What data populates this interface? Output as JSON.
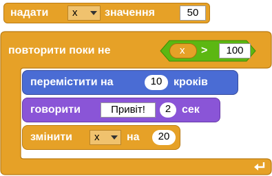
{
  "set_block": {
    "label": "надати",
    "variable": "x",
    "label2": "значення",
    "value": "50"
  },
  "repeat_block": {
    "label": "повторити поки не",
    "condition": {
      "variable": "x",
      "operator": ">",
      "value": "100"
    }
  },
  "move_block": {
    "label": "перемістити на",
    "steps": "10",
    "unit": "кроків"
  },
  "say_block": {
    "label": "говорити",
    "message": "Привіт!",
    "seconds": "2",
    "unit": "сек"
  },
  "change_block": {
    "label": "змінити",
    "variable": "x",
    "label2": "на",
    "value": "20"
  },
  "colors": {
    "control": "#E6A127",
    "motion": "#4A6CD4",
    "looks": "#8A55D7",
    "operator": "#5CB712",
    "data": "#E6A127"
  },
  "icons": {
    "loop_arrow": "loop-arrow-icon"
  }
}
